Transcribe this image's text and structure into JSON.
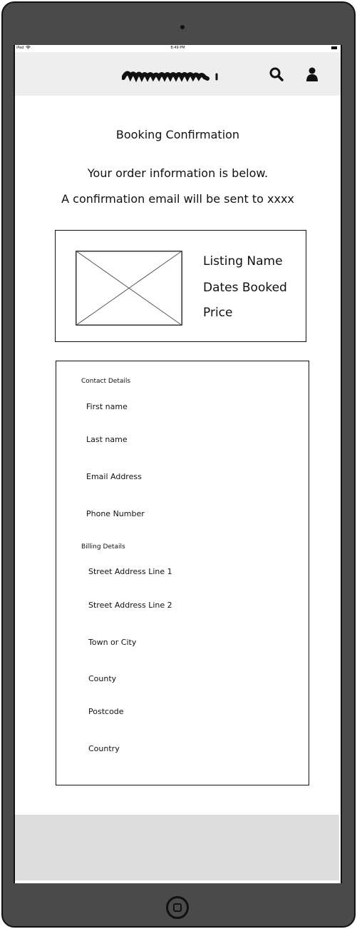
{
  "status_bar": {
    "device": "iPad",
    "time": "8:49 PM"
  },
  "header": {
    "logo_icon": "scribble-logo",
    "search_icon": "search-icon",
    "user_icon": "user-icon"
  },
  "page": {
    "title": "Booking Confirmation",
    "info_line1": "Your order information is below.",
    "info_line2": "A confirmation email will be sent to xxxx"
  },
  "listing": {
    "name": "Listing Name",
    "dates": "Dates Booked",
    "price": "Price"
  },
  "contact": {
    "heading": "Contact Details",
    "fields": [
      "First name",
      "Last name",
      "Email Address",
      "Phone Number"
    ]
  },
  "billing": {
    "heading": "Billing Details",
    "fields": [
      "Street Address Line 1",
      "Street Address Line 2",
      "Town or City",
      "County",
      "Postcode",
      "Country"
    ]
  }
}
